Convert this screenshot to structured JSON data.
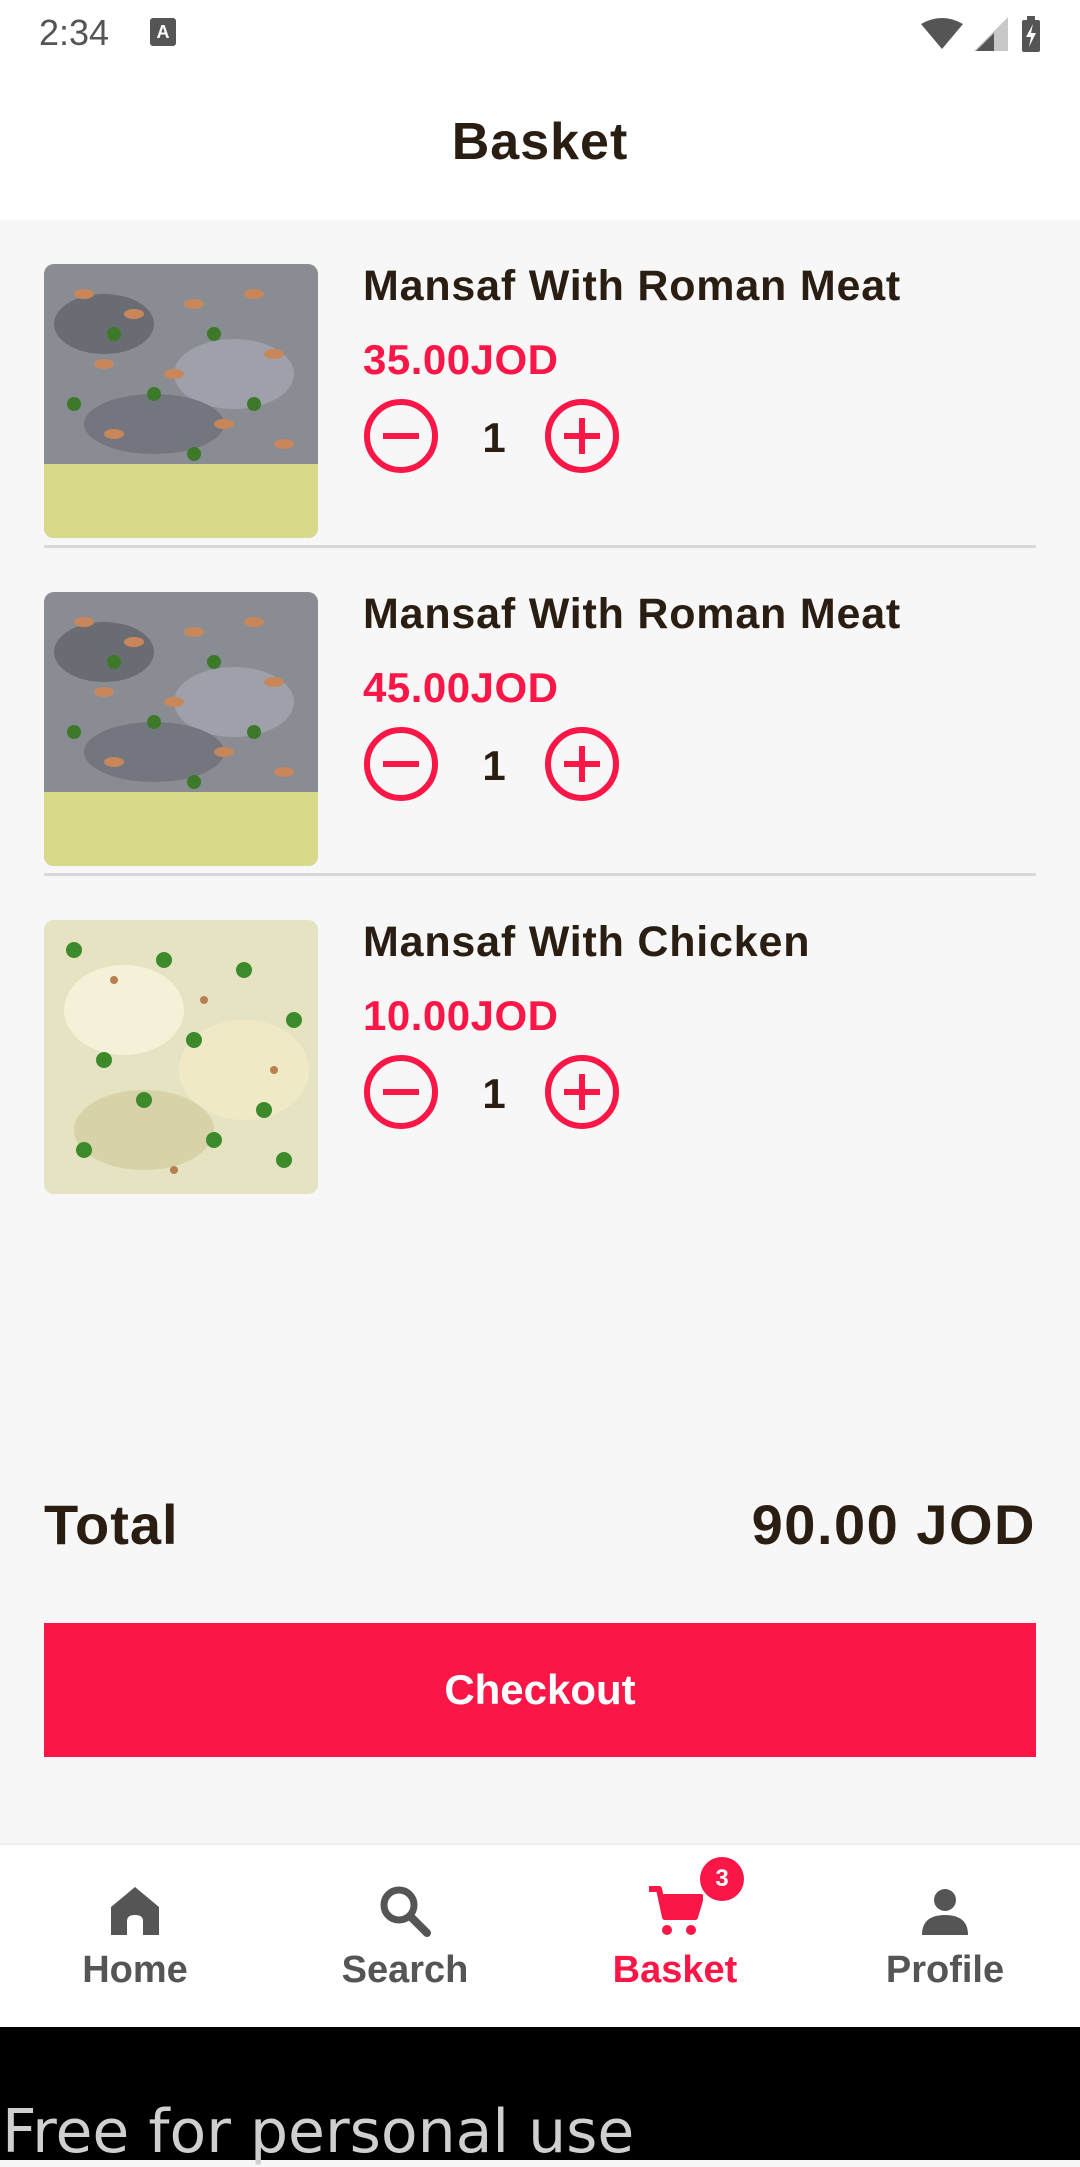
{
  "status_bar": {
    "time": "2:34",
    "notification_icon": "A"
  },
  "header": {
    "title": "Basket"
  },
  "basket": {
    "items": [
      {
        "name": "Mansaf With Roman Meat",
        "price": "35.00JOD",
        "quantity": "1",
        "image": "mansaf-meat-photo"
      },
      {
        "name": "Mansaf With Roman Meat",
        "price": "45.00JOD",
        "quantity": "1",
        "image": "mansaf-meat-photo"
      },
      {
        "name": "Mansaf With Chicken",
        "price": "10.00JOD",
        "quantity": "1",
        "image": "mansaf-chicken-photo"
      }
    ]
  },
  "summary": {
    "total_label": "Total",
    "total_value": "90.00 JOD"
  },
  "checkout": {
    "label": "Checkout"
  },
  "nav": {
    "items": [
      {
        "label": "Home",
        "icon": "home-icon"
      },
      {
        "label": "Search",
        "icon": "search-icon"
      },
      {
        "label": "Basket",
        "icon": "cart-icon",
        "badge": "3",
        "active": true
      },
      {
        "label": "Profile",
        "icon": "profile-icon"
      }
    ]
  },
  "watermark": {
    "text": "Free for personal use"
  },
  "colors": {
    "accent": "#fa1646",
    "text": "#2a1e12",
    "background": "#f7f7f7"
  }
}
